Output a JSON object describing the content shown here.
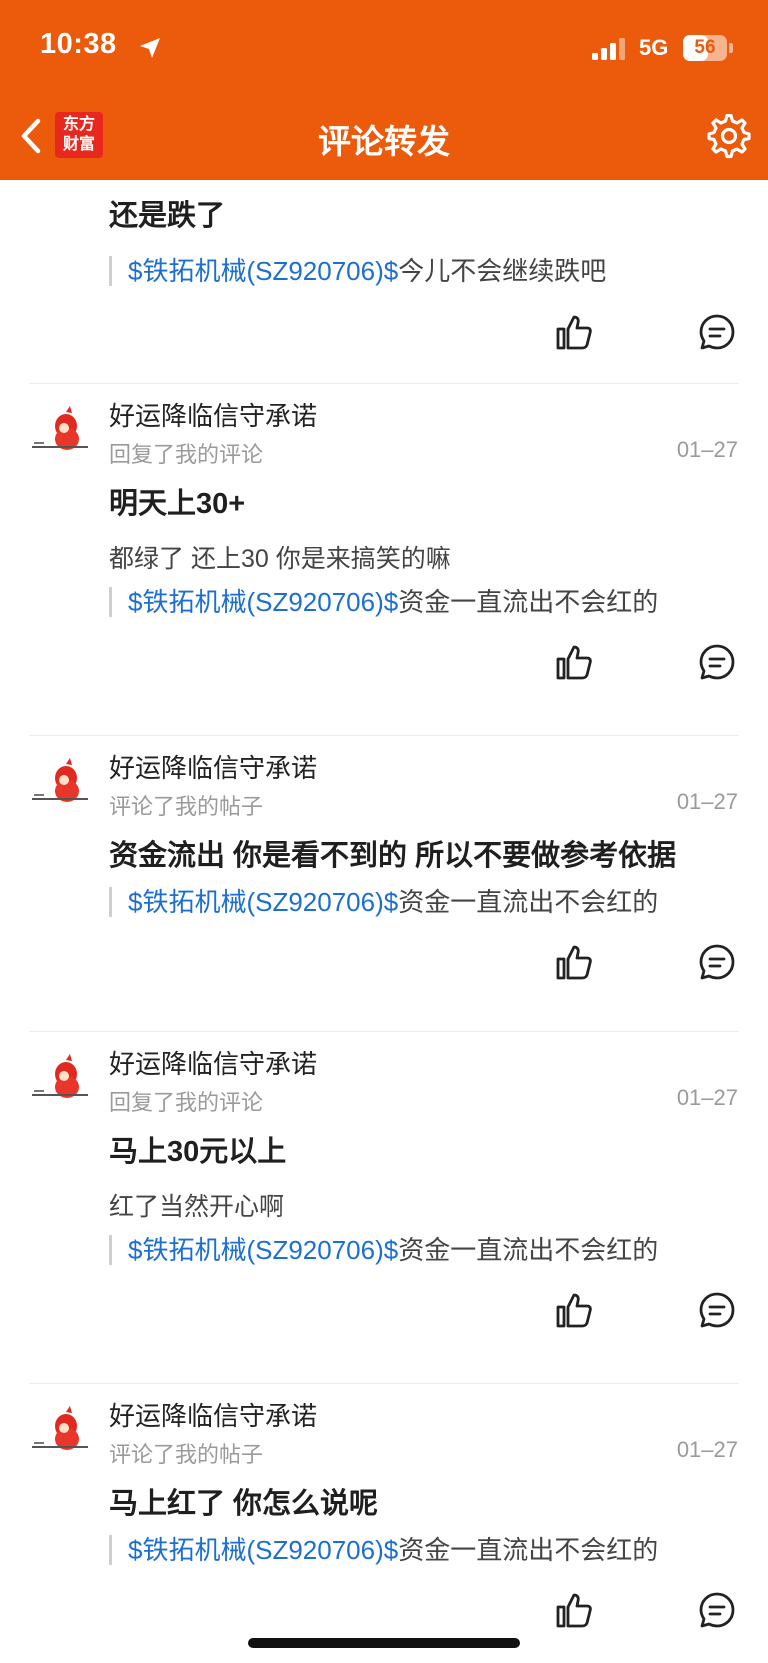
{
  "status_bar": {
    "time": "10:38",
    "network": "5G",
    "battery": "56",
    "battery_level": 0.56
  },
  "header": {
    "logo_line1": "东方",
    "logo_line2": "财富",
    "title": "评论转发"
  },
  "feed": [
    {
      "partial": true,
      "main_text": "还是跌了",
      "quote_stock": "$铁拓机械(SZ920706)$",
      "quote_text": "今儿不会继续跌吧"
    },
    {
      "username": "好运降临信守承诺",
      "action": "回复了我的评论",
      "date": "01–27",
      "main_text": "明天上30+",
      "sub_text": "都绿了 还上30  你是来搞笑的嘛",
      "quote_stock": "$铁拓机械(SZ920706)$",
      "quote_text": "资金一直流出不会红的"
    },
    {
      "username": "好运降临信守承诺",
      "action": "评论了我的帖子",
      "date": "01–27",
      "main_text": "资金流出 你是看不到的 所以不要做参考依据",
      "quote_stock": "$铁拓机械(SZ920706)$",
      "quote_text": "资金一直流出不会红的"
    },
    {
      "username": "好运降临信守承诺",
      "action": "回复了我的评论",
      "date": "01–27",
      "main_text": "马上30元以上",
      "sub_text": "红了当然开心啊",
      "quote_stock": "$铁拓机械(SZ920706)$",
      "quote_text": "资金一直流出不会红的"
    },
    {
      "username": "好运降临信守承诺",
      "action": "评论了我的帖子",
      "date": "01–27",
      "main_text": "马上红了  你怎么说呢",
      "quote_stock": "$铁拓机械(SZ920706)$",
      "quote_text": "资金一直流出不会红的"
    }
  ],
  "colors": {
    "brand": "#ec5a0b",
    "link": "#1c6fd1",
    "logo_bg": "#e8281e"
  }
}
